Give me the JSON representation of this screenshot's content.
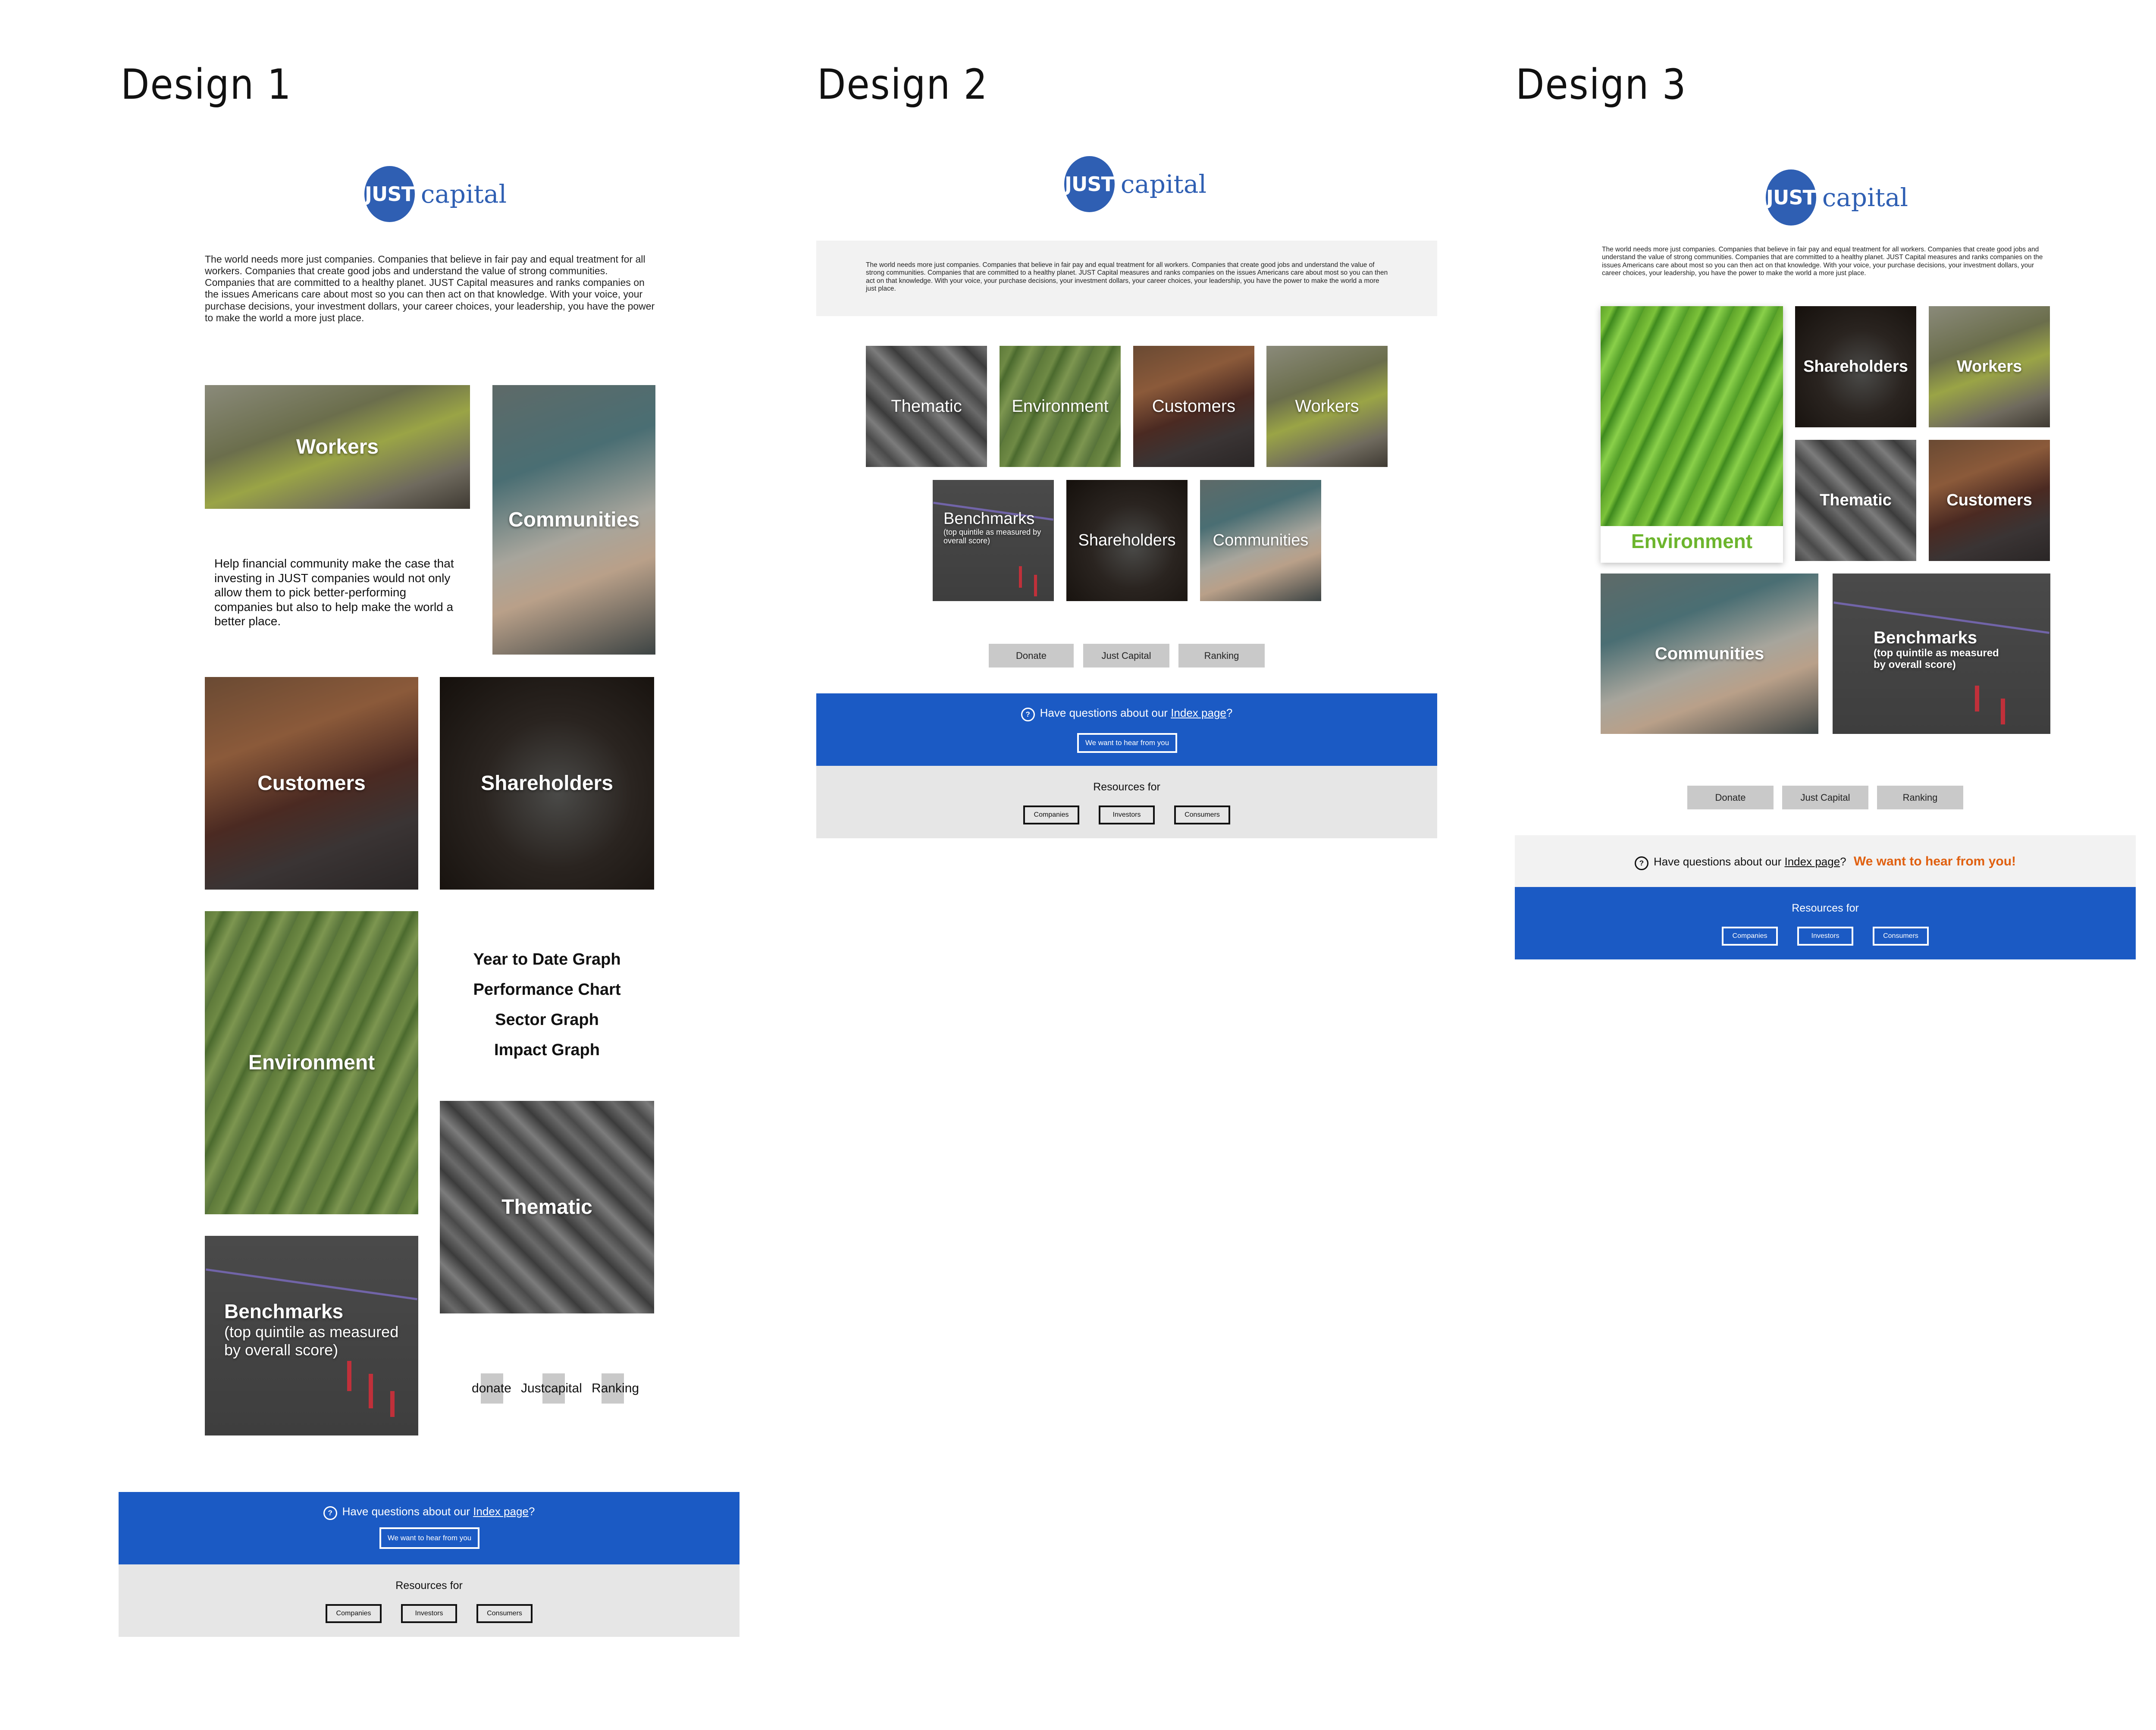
{
  "titles": {
    "d1": "Design 1",
    "d2": "Design 2",
    "d3": "Design 3"
  },
  "logo": {
    "mark": "JUST",
    "word": "capital"
  },
  "intro_text": "The world needs more just companies. Companies that believe in fair pay and equal treatment for all workers. Companies that create good jobs and understand the value of strong communities. Companies that are committed to a healthy planet. JUST Capital measures and ranks companies on the issues Americans care about most so you can then act on that knowledge. With your voice, your purchase decisions, your investment dollars, your career choices, your leadership, you have the power to make the world a more just place.",
  "categories": {
    "workers": "Workers",
    "communities": "Communities",
    "customers": "Customers",
    "shareholders": "Shareholders",
    "environment": "Environment",
    "thematic": "Thematic",
    "benchmarks": "Benchmarks",
    "benchmarks_sub": "(top quintile as measured by overall score)"
  },
  "d1": {
    "help_text": "Help financial community make the case that investing in JUST companies would not only allow them to pick better-performing companies but also to help make the world a better place.",
    "graphs": [
      "Year to Date Graph",
      "Performance Chart",
      "Sector Graph",
      "Impact Graph"
    ],
    "small_links": [
      "donate",
      "Justcapital",
      "Ranking"
    ]
  },
  "actions": [
    "Donate",
    "Just Capital",
    "Ranking"
  ],
  "footer": {
    "question_prefix": "Have questions about our",
    "question_link": "Index page",
    "question_suffix": "?",
    "cta": "We want to hear from you",
    "cta_d3": "We want to hear from you!",
    "resources_label": "Resources for",
    "resources": [
      "Companies",
      "Investors",
      "Consumers"
    ],
    "question_icon": "?"
  },
  "colors": {
    "brand_blue": "#1b5ac4",
    "logo_blue": "#2f5fb3",
    "env_green": "#6cb52d",
    "cta_orange": "#e06010"
  }
}
